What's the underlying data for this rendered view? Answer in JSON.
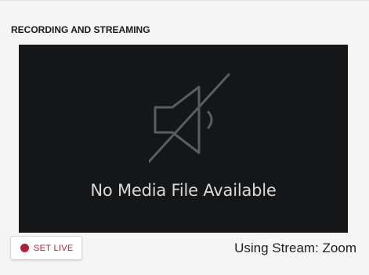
{
  "section": {
    "title": "RECORDING AND STREAMING"
  },
  "media": {
    "empty_message": "No Media File Available",
    "icon": "speaker-muted-icon"
  },
  "controls": {
    "set_live_label": "SET LIVE",
    "live_dot_color": "#b32033"
  },
  "stream": {
    "status_text": "Using Stream: Zoom"
  },
  "colors": {
    "background": "#f5f5f5",
    "media_background": "#151618",
    "accent_red": "#b32033"
  }
}
